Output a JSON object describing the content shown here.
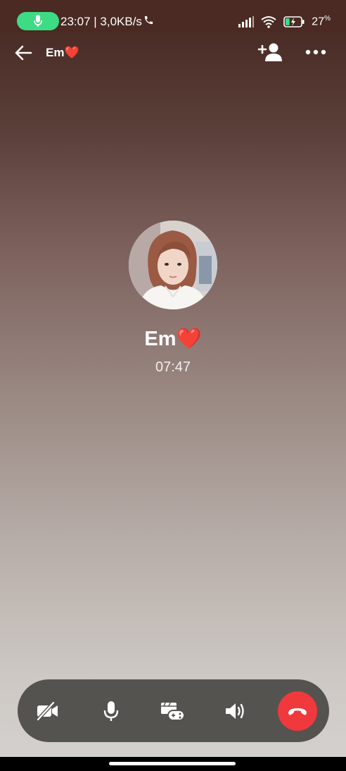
{
  "status_bar": {
    "time_speed": "23:07 | 3,0KB/s",
    "battery_percent": "27",
    "battery_unit": "%",
    "battery_level": 0.27
  },
  "header": {
    "title": "Em❤️"
  },
  "caller": {
    "name": "Em❤️",
    "duration": "07:47"
  },
  "controls": {
    "icons": [
      "camera-off-icon",
      "microphone-icon",
      "game-icon",
      "speaker-icon",
      "end-call-icon"
    ]
  },
  "colors": {
    "end_call": "#f0393c",
    "mic_pill": "#3ddc84",
    "control_bar": "#55534f"
  }
}
